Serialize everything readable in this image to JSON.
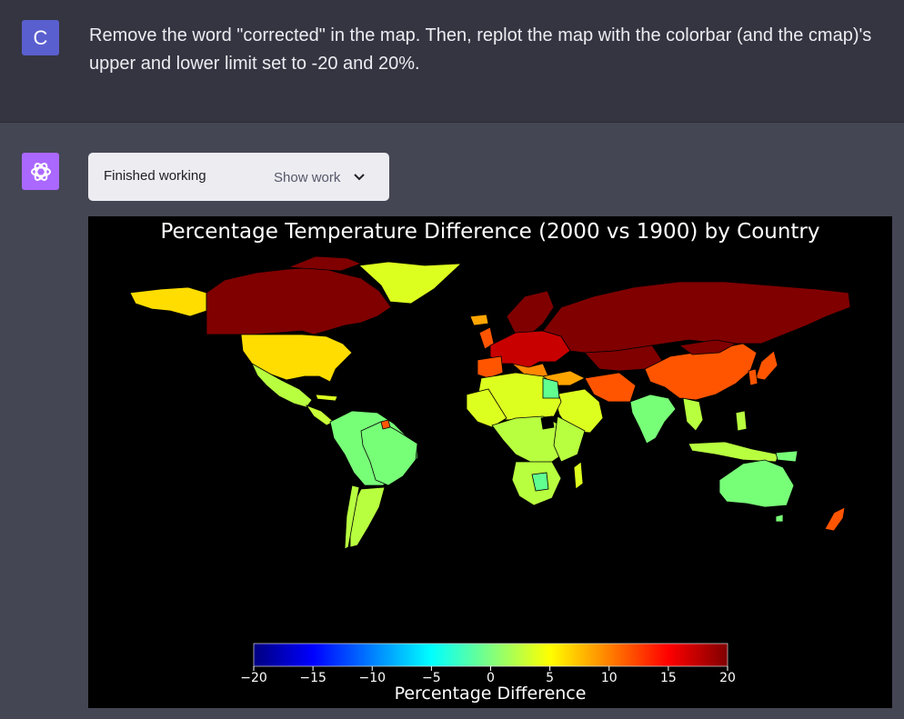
{
  "user_message": {
    "avatar_initial": "C",
    "text": "Remove the word \"corrected\" in the map. Then, replot the map with the colorbar (and the cmap)'s upper and lower limit set to -20 and 20%."
  },
  "assistant": {
    "avatar_icon": "openai-logo-icon",
    "work_status": "Finished working",
    "show_work_label": "Show work"
  },
  "chart_data": {
    "type": "choropleth-map",
    "title": "Percentage Temperature Difference (2000 vs 1900) by Country",
    "colorbar": {
      "label": "Percentage Difference",
      "cmap": "jet",
      "vmin": -20,
      "vmax": 20,
      "ticks": [
        "−20",
        "−15",
        "−10",
        "−5",
        "0",
        "5",
        "10",
        "15",
        "20"
      ]
    },
    "colors": {
      "dark_red": "#800000",
      "red": "#c80000",
      "orange": "#ff5500",
      "amber": "#ffa500",
      "yellow": "#ffdd00",
      "yellow_green": "#ddff20",
      "lime": "#b8ff40",
      "green": "#78ff78",
      "teal_green": "#60ff90"
    }
  }
}
